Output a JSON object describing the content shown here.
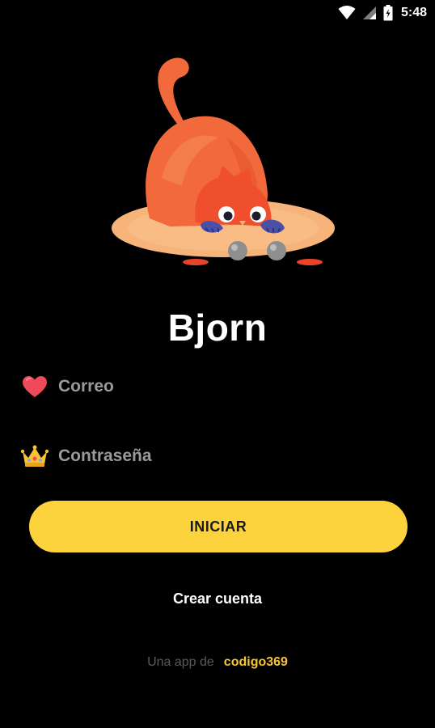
{
  "status_bar": {
    "time": "5:48",
    "icons": [
      "wifi-icon",
      "signal-icon",
      "battery-icon"
    ]
  },
  "app": {
    "title": "Bjorn"
  },
  "login": {
    "email_placeholder": "Correo",
    "password_placeholder": "Contraseña",
    "email_icon": "heart-icon",
    "password_icon": "crown-icon",
    "start_label": "INICIAR",
    "create_account_label": "Crear cuenta"
  },
  "footer": {
    "prefix": "Una app de",
    "brand": "codigo369"
  },
  "colors": {
    "background": "#000000",
    "accent": "#fdd33d",
    "brand": "#f5c533",
    "cat": "#f26a3b"
  }
}
